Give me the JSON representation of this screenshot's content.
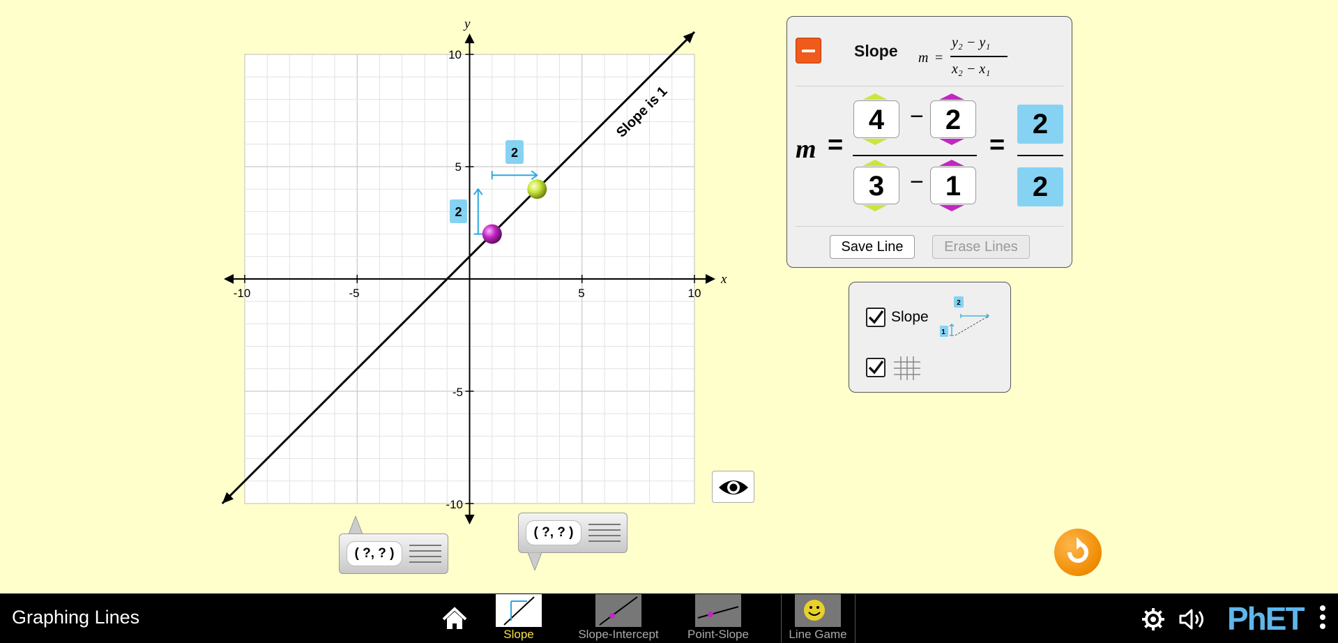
{
  "graph": {
    "axis_x_label": "x",
    "axis_y_label": "y",
    "x_ticks": [
      "-10",
      "-5",
      "5",
      "10"
    ],
    "y_ticks": [
      "10",
      "5",
      "-5",
      "-10"
    ],
    "line_label": "Slope is 1",
    "rise_label": "2",
    "run_label": "2",
    "point1": {
      "x": 1,
      "y": 2,
      "color": "#c227c2"
    },
    "point2": {
      "x": 3,
      "y": 4,
      "color": "#c8e63c"
    }
  },
  "equation_panel": {
    "title": "Slope",
    "formula": {
      "m": "m",
      "eq": "=",
      "num": "y₂ − y₁",
      "den": "x₂ − x₁"
    },
    "m_symbol": "m",
    "equals": "=",
    "minus": "−",
    "y2": "4",
    "y1": "2",
    "x2": "3",
    "x1": "1",
    "result_num": "2",
    "result_den": "2",
    "save_line_label": "Save Line",
    "erase_lines_label": "Erase Lines"
  },
  "visibility_panel": {
    "slope_label": "Slope",
    "slope_icon_rise": "1",
    "slope_icon_run": "2",
    "slope_checked": true,
    "grid_checked": true
  },
  "point_tools": [
    {
      "value": "( ?, ? )"
    },
    {
      "value": "( ?, ? )"
    }
  ],
  "navbar": {
    "title": "Graphing Lines",
    "tabs": [
      {
        "label": "Slope",
        "selected": true
      },
      {
        "label": "Slope-Intercept",
        "selected": false
      },
      {
        "label": "Point-Slope",
        "selected": false
      },
      {
        "label": "Line Game",
        "selected": false
      }
    ],
    "brand": "PhET"
  },
  "colors": {
    "background": "#ffffcc",
    "accent_orange": "#f05a1a",
    "slope_blue": "#85d2f2",
    "point_yellow": "#c8e63c",
    "point_magenta": "#c227c2",
    "nav_selected": "#f5e34a"
  }
}
